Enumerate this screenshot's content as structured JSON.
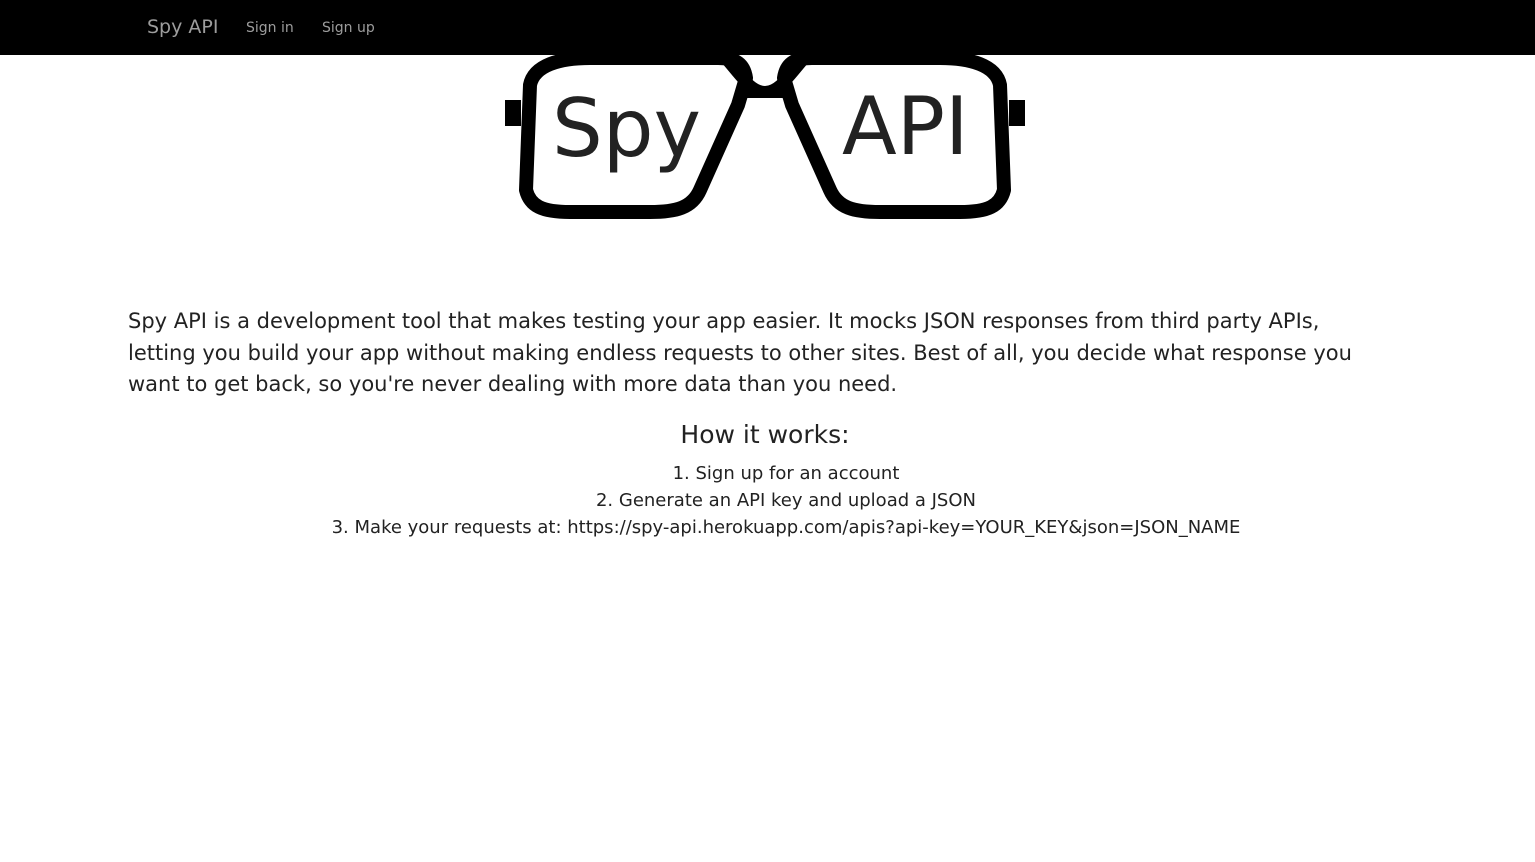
{
  "navbar": {
    "brand": "Spy API",
    "links": [
      "Sign in",
      "Sign up"
    ]
  },
  "logo": {
    "left_lens": "Spy",
    "right_lens": "API"
  },
  "intro": "Spy API is a development tool that makes testing your app easier. It mocks JSON responses from third party APIs, letting you build your app without making endless requests to other sites. Best of all, you decide what response you want to get back, so you're never dealing with more data than you need.",
  "how_it_works": {
    "title": "How it works:",
    "steps": [
      "1. Sign up for an account",
      "2. Generate an API key and upload a JSON",
      "3. Make your requests at: https://spy-api.herokuapp.com/apis?api-key=YOUR_KEY&json=JSON_NAME"
    ]
  },
  "colors": {
    "navbar_bg": "#000000",
    "nav_text": "#9d9d9d",
    "body_text": "#222222"
  }
}
